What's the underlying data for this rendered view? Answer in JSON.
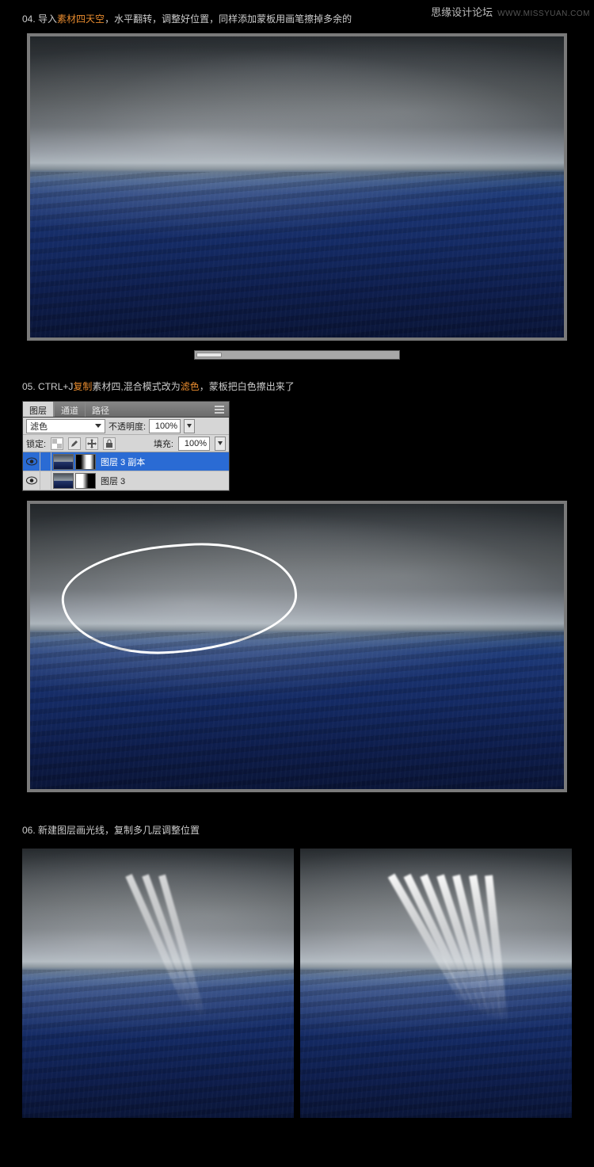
{
  "watermark": {
    "brand": "思缘设计论坛",
    "url": "WWW.MISSYUAN.COM"
  },
  "step04": {
    "num": "04.",
    "pre": "导入",
    "hl": "素材四天空",
    "post": "，水平翻转，调整好位置，同样添加蒙板用画笔擦掉多余的"
  },
  "step05": {
    "num": "05.",
    "pre": "CTRL+J",
    "hl1": "复制",
    "mid": "素材四,混合模式改为",
    "hl2": "滤色",
    "post": "，蒙板把白色擦出来了"
  },
  "step06": {
    "num": "06.",
    "text": "新建图层画光线，复制多几层调整位置"
  },
  "panel": {
    "tabs": {
      "layers": "图层",
      "channels": "通道",
      "paths": "路径"
    },
    "blendMode": "滤色",
    "opacityLabel": "不透明度:",
    "opacityValue": "100%",
    "lockLabel": "锁定:",
    "fillLabel": "填充:",
    "fillValue": "100%",
    "layer1": "图层 3 副本",
    "layer2": "图层 3"
  }
}
